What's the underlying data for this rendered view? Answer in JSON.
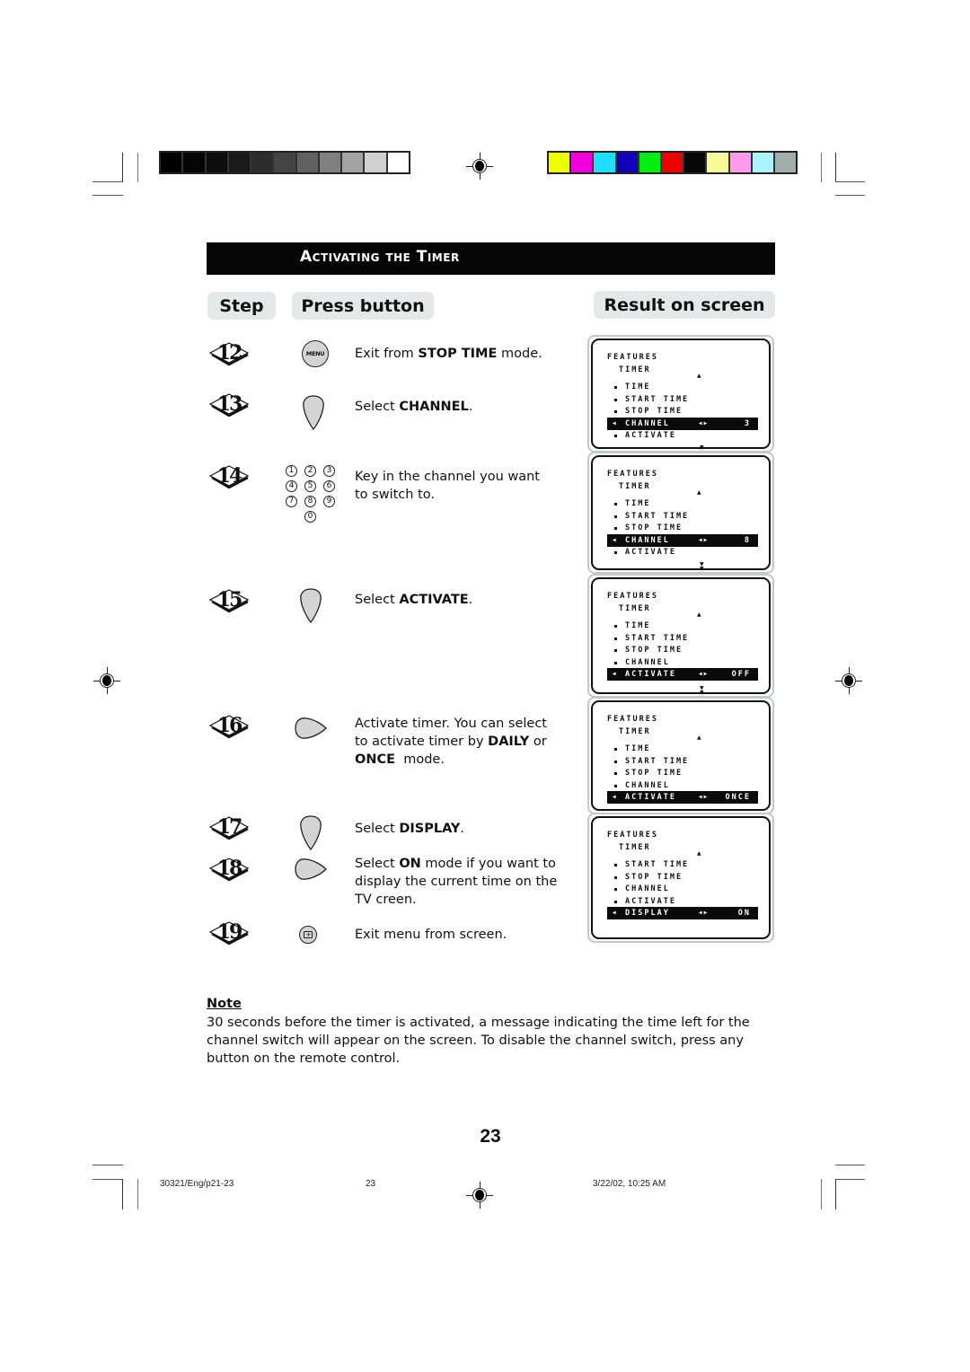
{
  "print_marks": {
    "grayscale_bar": [
      "#000000",
      "#050505",
      "#0d0d0d",
      "#1a1a1a",
      "#2c2c2c",
      "#444444",
      "#616161",
      "#808080",
      "#a3a3a3",
      "#d0d0d0",
      "#ffffff"
    ],
    "color_bar": [
      "#eeff00",
      "#ee00dd",
      "#22ddff",
      "#1100bb",
      "#00ee11",
      "#ee0000",
      "#080808",
      "#f8f89a",
      "#ff99ee",
      "#aaf4ff",
      "#a2aeae"
    ]
  },
  "section": {
    "title": "Activating the Timer"
  },
  "headers": {
    "step": "Step",
    "press_button": "Press button",
    "result": "Result on screen"
  },
  "steps": [
    {
      "num": "12",
      "button": "menu-button",
      "button_label": "MENU",
      "text_pre": "Exit from ",
      "text_bold": "STOP TIME",
      "text_post": " mode."
    },
    {
      "num": "13",
      "button": "down-cursor-button",
      "text_pre": "Select ",
      "text_bold": "CHANNEL",
      "text_post": "."
    },
    {
      "num": "14",
      "button": "digit-buttons",
      "digits": [
        "1",
        "2",
        "3",
        "4",
        "5",
        "6",
        "7",
        "8",
        "9",
        "0"
      ],
      "text": "Key in the channel you want to switch to."
    },
    {
      "num": "15",
      "button": "down-cursor-button",
      "text_pre": "Select ",
      "text_bold": "ACTIVATE",
      "text_post": "."
    },
    {
      "num": "16",
      "button": "right-cursor-button",
      "line1": "Activate timer. You can select",
      "line2_pre": "to activate timer by ",
      "line2_bold": "DAILY",
      "line2_post": " or",
      "line3_bold": "ONCE",
      "line3_post": "  mode."
    },
    {
      "num": "17",
      "button": "down-cursor-button",
      "text_pre": "Select ",
      "text_bold": "DISPLAY",
      "text_post": "."
    },
    {
      "num": "18",
      "button": "right-cursor-button",
      "line1_pre": "Select ",
      "line1_bold": "ON",
      "line1_post": " mode if you want to",
      "line2": "display the current time on the",
      "line3": "TV creen."
    },
    {
      "num": "19",
      "button": "exit-button",
      "text": "Exit menu from screen."
    }
  ],
  "screens": [
    {
      "title": "FEATURES",
      "subtitle": "TIMER",
      "items": [
        "TIME",
        "START TIME",
        "STOP TIME"
      ],
      "selected": {
        "label": "CHANNEL",
        "value": "3"
      },
      "after": [
        "ACTIVATE"
      ]
    },
    {
      "title": "FEATURES",
      "subtitle": "TIMER",
      "items": [
        "TIME",
        "START TIME",
        "STOP TIME"
      ],
      "selected": {
        "label": "CHANNEL",
        "value": "8"
      },
      "after": [
        "ACTIVATE"
      ]
    },
    {
      "title": "FEATURES",
      "subtitle": "TIMER",
      "items": [
        "TIME",
        "START TIME",
        "STOP TIME",
        "CHANNEL"
      ],
      "selected": {
        "label": "ACTIVATE",
        "value": "OFF"
      },
      "after": []
    },
    {
      "title": "FEATURES",
      "subtitle": "TIMER",
      "items": [
        "TIME",
        "START TIME",
        "STOP TIME",
        "CHANNEL"
      ],
      "selected": {
        "label": "ACTIVATE",
        "value": "ONCE"
      },
      "after": []
    },
    {
      "title": "FEATURES",
      "subtitle": "TIMER",
      "items": [
        "START TIME",
        "STOP TIME",
        "CHANNEL",
        "ACTIVATE"
      ],
      "selected": {
        "label": "DISPLAY",
        "value": "ON"
      },
      "after": []
    }
  ],
  "note": {
    "heading": "Note",
    "body": "30 seconds before the timer is activated, a message indicating the time left for the channel switch will appear on the screen. To disable the channel switch, press any button on the remote control."
  },
  "page_number": "23",
  "slug": {
    "file": "30321/Eng/p21-23",
    "page": "23",
    "date": "3/22/02, 10:25 AM"
  }
}
